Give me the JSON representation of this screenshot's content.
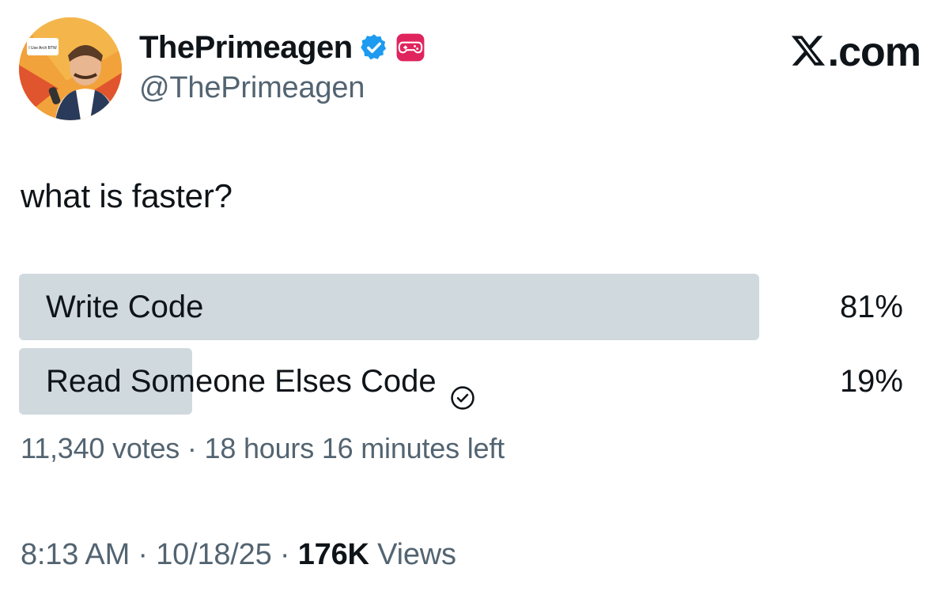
{
  "header": {
    "display_name": "ThePrimeagen",
    "handle": "@ThePrimeagen",
    "brand": ".com",
    "avatar_sign_text": "I Use Arch BTW"
  },
  "tweet": {
    "text": "what is faster?"
  },
  "poll": {
    "options": [
      {
        "label": "Write Code",
        "percent_text": "81%",
        "percent": 81,
        "selected": false
      },
      {
        "label": "Read Someone Elses Code",
        "percent_text": "19%",
        "percent": 19,
        "selected": true
      }
    ],
    "votes": "11,340 votes",
    "separator": "·",
    "time_left": "18 hours 16 minutes left"
  },
  "footer": {
    "time": "8:13 AM",
    "date": "10/18/25",
    "views_count": "176K",
    "views_label": "Views",
    "separator": "·"
  },
  "colors": {
    "text": "#0f1419",
    "secondary": "#536471",
    "poll_bar": "#cfd9de",
    "verified": "#1d9bf0",
    "controller": "#e0245e"
  },
  "icons": {
    "verified": "verified-badge-icon",
    "controller": "game-controller-icon",
    "x_logo": "x-logo-icon",
    "check": "check-circle-icon"
  }
}
